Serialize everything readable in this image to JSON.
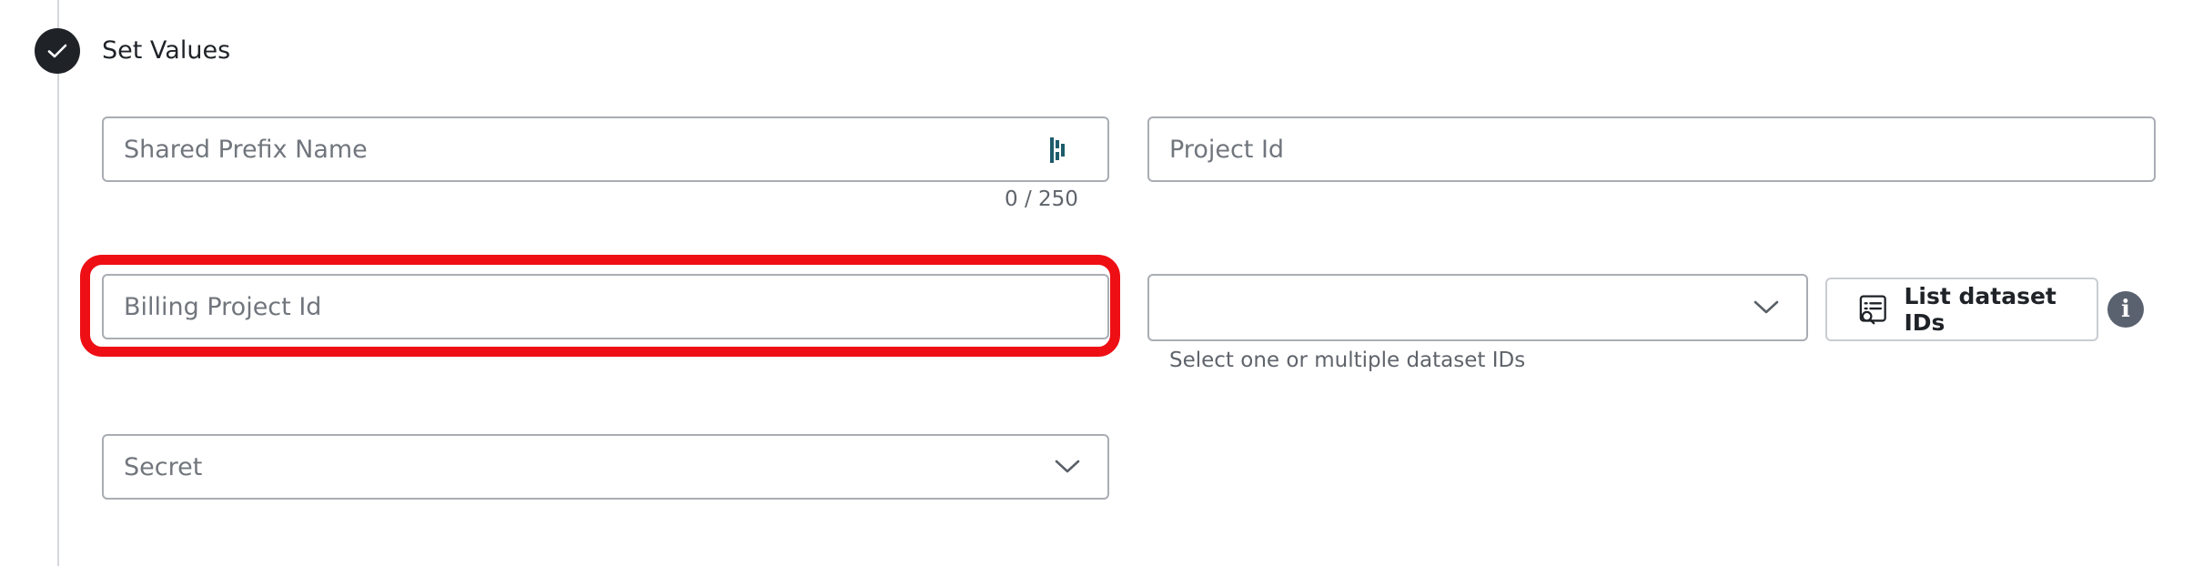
{
  "step": {
    "title": "Set Values",
    "status_icon": "check-icon"
  },
  "fields": {
    "shared_prefix": {
      "placeholder": "Shared Prefix Name",
      "value": "",
      "counter": "0 / 250",
      "trailing_icon": "dbt-logo-icon"
    },
    "project_id": {
      "placeholder": "Project Id",
      "value": ""
    },
    "billing_project_id": {
      "placeholder": "Billing Project Id",
      "value": ""
    },
    "dataset_ids": {
      "selected": "",
      "helper": "Select one or multiple dataset IDs",
      "trailing_icon": "chevron-down-icon"
    },
    "secret": {
      "placeholder": "Secret",
      "trailing_icon": "chevron-down-icon"
    }
  },
  "list_button": {
    "label": "List dataset IDs",
    "icon": "list-search-icon"
  },
  "info": {
    "icon": "info-icon"
  },
  "colors": {
    "highlight": "#ee0f14",
    "brand_icon": "#1d5c6b",
    "dark": "#1f2328",
    "info_bg": "#5a6270"
  }
}
